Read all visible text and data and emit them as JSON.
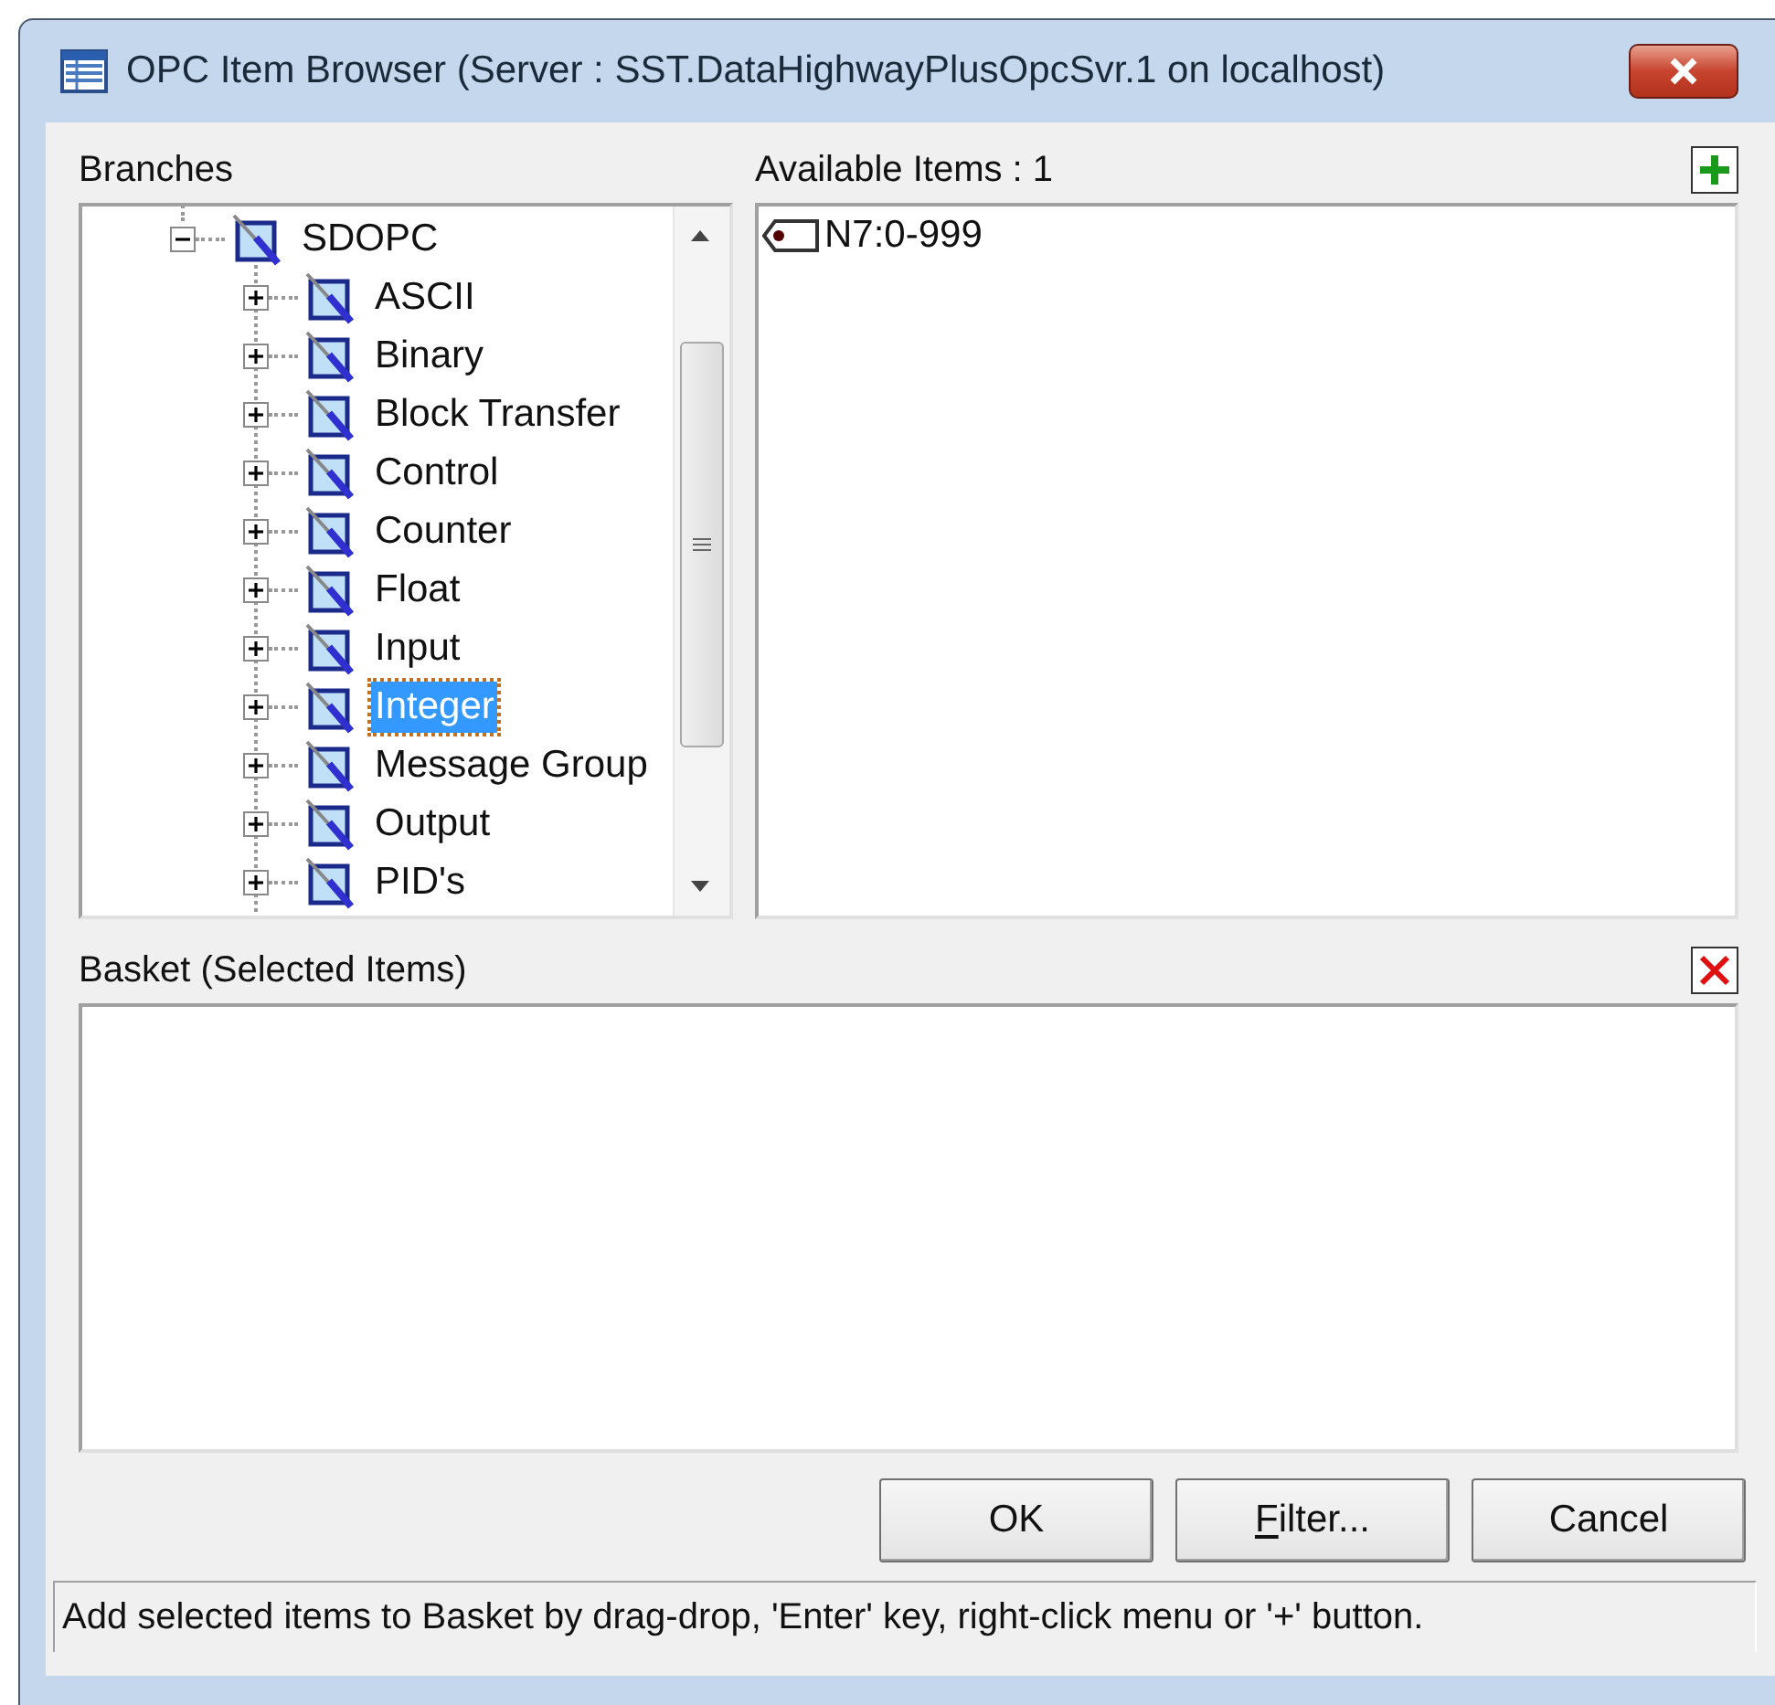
{
  "window": {
    "title": "OPC Item Browser (Server : SST.DataHighwayPlusOpcSvr.1 on localhost)"
  },
  "branches": {
    "label": "Branches",
    "tree": [
      {
        "label": "SDOPC",
        "expanded": true,
        "selected": false,
        "children": [
          {
            "label": "ASCII",
            "expanded": false,
            "selected": false
          },
          {
            "label": "Binary",
            "expanded": false,
            "selected": false
          },
          {
            "label": "Block Transfer",
            "expanded": false,
            "selected": false
          },
          {
            "label": "Control",
            "expanded": false,
            "selected": false
          },
          {
            "label": "Counter",
            "expanded": false,
            "selected": false
          },
          {
            "label": "Float",
            "expanded": false,
            "selected": false
          },
          {
            "label": "Input",
            "expanded": false,
            "selected": false
          },
          {
            "label": "Integer",
            "expanded": false,
            "selected": true
          },
          {
            "label": "Message Group",
            "expanded": false,
            "selected": false
          },
          {
            "label": "Output",
            "expanded": false,
            "selected": false
          },
          {
            "label": "PID's",
            "expanded": false,
            "selected": false
          }
        ]
      }
    ]
  },
  "available_items": {
    "label": "Available Items : 1",
    "items": [
      {
        "label": "N7:0-999"
      }
    ]
  },
  "basket": {
    "label": "Basket (Selected Items)"
  },
  "buttons": [
    {
      "label": "OK",
      "underline_first": false
    },
    {
      "label": "Filter...",
      "underline_first": true
    },
    {
      "label": "Cancel",
      "underline_first": false
    }
  ],
  "status_bar": "Add selected items to Basket by drag-drop, 'Enter' key, right-click menu or '+' button."
}
